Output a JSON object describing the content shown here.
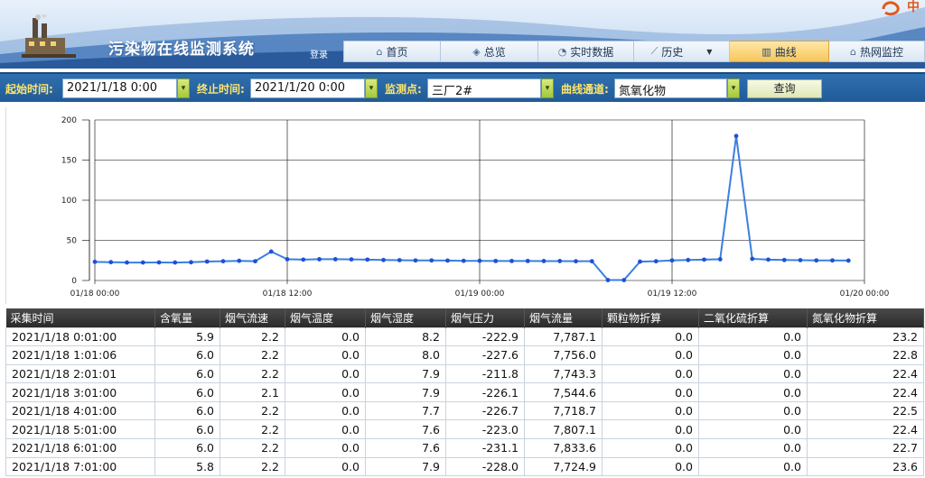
{
  "header": {
    "system_title": "污染物在线监测系统",
    "login_label": "登录"
  },
  "nav": {
    "items": [
      {
        "label": "首页",
        "icon": "home-icon",
        "active": false
      },
      {
        "label": "总览",
        "icon": "layers-icon",
        "active": false
      },
      {
        "label": "实时数据",
        "icon": "gauge-icon",
        "active": false
      },
      {
        "label": "历史",
        "icon": "line-chart-icon",
        "active": false,
        "has_dropdown": true
      },
      {
        "label": "曲线",
        "icon": "bar-chart-icon",
        "active": true
      },
      {
        "label": "热网监控",
        "icon": "home-icon",
        "active": false
      }
    ]
  },
  "query": {
    "start_label": "起始时间:",
    "start_value": "2021/1/18 0:00",
    "end_label": "终止时间:",
    "end_value": "2021/1/20 0:00",
    "point_label": "监测点:",
    "point_value": "三厂2#",
    "channel_label": "曲线通道:",
    "channel_value": "氮氧化物",
    "query_button": "查询"
  },
  "chart_data": {
    "type": "line",
    "title": "",
    "xlabel": "",
    "ylabel": "",
    "ylim": [
      0,
      200
    ],
    "yticks": [
      "0",
      "50",
      "100",
      "150",
      "200"
    ],
    "xticks": [
      "01/18 00:00",
      "01/18 12:00",
      "01/19 00:00",
      "01/19 12:00",
      "01/20 00:00"
    ],
    "xlim_hours": [
      0,
      48
    ],
    "grid": true,
    "color": "#3a7fe0",
    "series": [
      {
        "x": [
          0,
          1,
          2,
          3,
          4,
          5,
          6,
          7,
          8,
          9,
          10,
          11,
          12,
          13,
          14,
          15,
          16,
          17,
          18,
          19,
          20,
          21,
          22,
          23,
          24,
          25,
          26,
          27,
          28,
          29,
          30,
          31,
          32,
          33,
          34,
          35,
          36,
          37,
          38,
          39,
          40,
          41,
          42,
          43,
          44,
          45,
          46,
          47
        ],
        "values": [
          23.2,
          22.8,
          22.4,
          22.4,
          22.5,
          22.4,
          22.7,
          23.6,
          24.0,
          24.5,
          24.0,
          36.0,
          26.5,
          26.0,
          26.5,
          26.5,
          26.3,
          26.0,
          25.5,
          25.3,
          25.0,
          25.0,
          24.8,
          24.5,
          24.5,
          24.3,
          24.3,
          24.3,
          24.2,
          24.2,
          24.0,
          24.0,
          0.5,
          0.5,
          23.5,
          24.0,
          25.0,
          25.5,
          26.0,
          26.5,
          180.0,
          27.0,
          26.0,
          25.5,
          25.3,
          25.0,
          25.0,
          24.8
        ]
      }
    ]
  },
  "table": {
    "columns": [
      "采集时间",
      "含氧量",
      "烟气流速",
      "烟气温度",
      "烟气湿度",
      "烟气压力",
      "烟气流量",
      "颗粒物折算",
      "二氧化硫折算",
      "氮氧化物折算"
    ],
    "rows": [
      [
        "2021/1/18 0:01:00",
        "5.9",
        "2.2",
        "0.0",
        "8.2",
        "-222.9",
        "7,787.1",
        "0.0",
        "0.0",
        "23.2"
      ],
      [
        "2021/1/18 1:01:06",
        "6.0",
        "2.2",
        "0.0",
        "8.0",
        "-227.6",
        "7,756.0",
        "0.0",
        "0.0",
        "22.8"
      ],
      [
        "2021/1/18 2:01:01",
        "6.0",
        "2.2",
        "0.0",
        "7.9",
        "-211.8",
        "7,743.3",
        "0.0",
        "0.0",
        "22.4"
      ],
      [
        "2021/1/18 3:01:00",
        "6.0",
        "2.1",
        "0.0",
        "7.9",
        "-226.1",
        "7,544.6",
        "0.0",
        "0.0",
        "22.4"
      ],
      [
        "2021/1/18 4:01:00",
        "6.0",
        "2.2",
        "0.0",
        "7.7",
        "-226.7",
        "7,718.7",
        "0.0",
        "0.0",
        "22.5"
      ],
      [
        "2021/1/18 5:01:00",
        "6.0",
        "2.2",
        "0.0",
        "7.6",
        "-223.0",
        "7,807.1",
        "0.0",
        "0.0",
        "22.4"
      ],
      [
        "2021/1/18 6:01:00",
        "6.0",
        "2.2",
        "0.0",
        "7.6",
        "-231.1",
        "7,833.6",
        "0.0",
        "0.0",
        "22.7"
      ],
      [
        "2021/1/18 7:01:00",
        "5.8",
        "2.2",
        "0.0",
        "7.9",
        "-228.0",
        "7,724.9",
        "0.0",
        "0.0",
        "23.6"
      ]
    ]
  }
}
